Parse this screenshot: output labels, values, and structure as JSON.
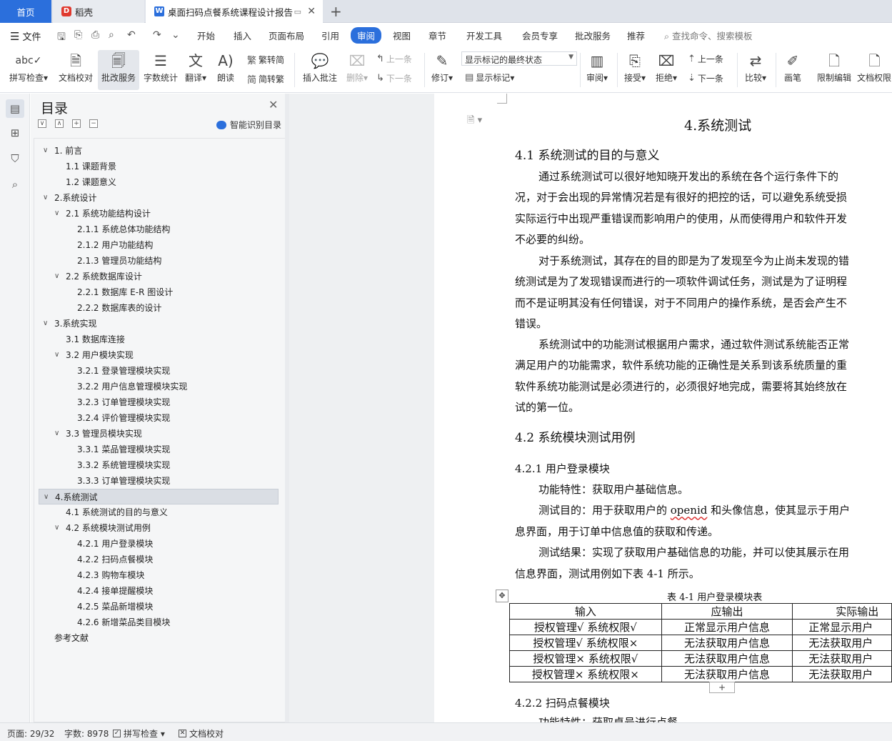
{
  "tabs": {
    "home": "首页",
    "daoke": "稻壳",
    "doc": "桌面扫码点餐系统课程设计报告"
  },
  "menu": {
    "file": "文件",
    "items": [
      "开始",
      "插入",
      "页面布局",
      "引用",
      "审阅",
      "视图",
      "章节",
      "开发工具",
      "会员专享",
      "批改服务",
      "推荐"
    ],
    "active": "审阅",
    "search": "查找命令、搜索模板"
  },
  "ribbon": {
    "spell": "拼写检查",
    "proof": "文档校对",
    "correct": "批改服务",
    "wordcount": "字数统计",
    "translate": "翻译",
    "read": "朗读",
    "trad": "繁转简",
    "simp": "简转繁",
    "insert_comment": "插入批注",
    "delete": "删除",
    "prev": "上一条",
    "next": "下一条",
    "revise": "修订",
    "display_state": "显示标记的最终状态",
    "show_marks": "显示标记",
    "review": "审阅",
    "accept": "接受",
    "reject": "拒绝",
    "prev2": "上一条",
    "next2": "下一条",
    "compare": "比较",
    "pen": "画笔",
    "restrict": "限制编辑",
    "perm": "文档权限"
  },
  "toc": {
    "title": "目录",
    "smart": "智能识别目录",
    "items": [
      {
        "text": "1.  前言",
        "level": 1,
        "toggle": "∨"
      },
      {
        "text": "1.1  课题背景",
        "level": 2
      },
      {
        "text": "1.2  课题意义",
        "level": 2
      },
      {
        "text": "2.系统设计",
        "level": 1,
        "toggle": "∨"
      },
      {
        "text": "2.1 系统功能结构设计",
        "level": 2,
        "toggle": "∨"
      },
      {
        "text": "2.1.1  系统总体功能结构",
        "level": 3
      },
      {
        "text": "2.1.2  用户功能结构",
        "level": 3
      },
      {
        "text": "2.1.3  管理员功能结构",
        "level": 3
      },
      {
        "text": "2.2  系统数据库设计",
        "level": 2,
        "toggle": "∨"
      },
      {
        "text": "2.2.1  数据库 E-R 图设计",
        "level": 3
      },
      {
        "text": "2.2.2  数据库表的设计",
        "level": 3
      },
      {
        "text": "3.系统实现",
        "level": 1,
        "toggle": "∨"
      },
      {
        "text": "3.1 数据库连接",
        "level": 2
      },
      {
        "text": "3.2 用户模块实现",
        "level": 2,
        "toggle": "∨"
      },
      {
        "text": "3.2.1  登录管理模块实现",
        "level": 3
      },
      {
        "text": "3.2.2  用户信息管理模块实现",
        "level": 3
      },
      {
        "text": "3.2.3  订单管理模块实现",
        "level": 3
      },
      {
        "text": "3.2.4  评价管理模块实现",
        "level": 3
      },
      {
        "text": "3.3  管理员模块实现",
        "level": 2,
        "toggle": "∨"
      },
      {
        "text": "3.3.1  菜品管理模块实现",
        "level": 3
      },
      {
        "text": "3.3.2  系统管理模块实现",
        "level": 3
      },
      {
        "text": "3.3.3  订单管理模块实现",
        "level": 3
      },
      {
        "text": "4.系统测试",
        "level": 1,
        "toggle": "∨",
        "selected": true
      },
      {
        "text": "4.1 系统测试的目的与意义",
        "level": 2
      },
      {
        "text": "4.2  系统模块测试用例",
        "level": 2,
        "toggle": "∨"
      },
      {
        "text": "4.2.1  用户登录模块",
        "level": 3
      },
      {
        "text": "4.2.2  扫码点餐模块",
        "level": 3
      },
      {
        "text": "4.2.3  购物车模块",
        "level": 3
      },
      {
        "text": "4.2.4  接单提醒模块",
        "level": 3
      },
      {
        "text": "4.2.5  菜品新增模块",
        "level": 3
      },
      {
        "text": "4.2.6  新增菜品类目模块",
        "level": 3
      },
      {
        "text": "参考文献",
        "level": 1
      }
    ]
  },
  "doc": {
    "chapter": "4.系统测试",
    "s41": "4.1 系统测试的目的与意义",
    "p1": [
      "通过系统测试可以很好地知晓开发出的系统在各个运行条件下的",
      "况，对于会出现的异常情况若是有很好的把控的话，可以避免系统受损",
      "实际运行中出现严重错误而影响用户的使用，从而使得用户和软件开发",
      "不必要的纠纷。"
    ],
    "p2": [
      "对于系统测试，其存在的目的即是为了发现至今为止尚未发现的错",
      "统测试是为了发现错误而进行的一项软件调试任务，测试是为了证明程",
      "而不是证明其没有任何错误，对于不同用户的操作系统，是否会产生不",
      "错误。"
    ],
    "p3": [
      "系统测试中的功能测试根据用户需求，通过软件测试系统能否正常",
      "满足用户的功能需求，软件系统功能的正确性是关系到该系统质量的重",
      "软件系统功能测试是必须进行的，必须很好地完成，需要将其始终放在",
      "试的第一位。"
    ],
    "s42": "4.2  系统模块测试用例",
    "s421": "4.2.1  用户登录模块",
    "func": "功能特性：获取用户基础信息。",
    "purpose_a": "测试目的：用于获取用户的 ",
    "purpose_word": "openid",
    "purpose_b": " 和头像信息，使其显示于用户",
    "purpose2": "息界面，用于订单中信息值的获取和传递。",
    "result": "测试结果：实现了获取用户基础信息的功能，并可以使其展示在用",
    "result2": "信息界面，测试用例如下表 4-1 所示。",
    "table_caption": "表 4-1  用户登录模块表",
    "table_headers": [
      "输入",
      "应输出",
      "实际输出"
    ],
    "table_rows": [
      [
        "授权管理√  系统权限√",
        "正常显示用户信息",
        "正常显示用户"
      ],
      [
        "授权管理√  系统权限×",
        "无法获取用户信息",
        "无法获取用户"
      ],
      [
        "授权管理×  系统权限√",
        "无法获取用户信息",
        "无法获取用户"
      ],
      [
        "授权管理×  系统权限×",
        "无法获取用户信息",
        "无法获取用户"
      ]
    ],
    "s422": "4.2.2  扫码点餐模块",
    "cut": "功能特性：获取桌号进行点餐"
  },
  "status": {
    "page": "页面: 29/32",
    "words": "字数: 8978",
    "spell": "拼写检查",
    "proof": "文档校对"
  }
}
